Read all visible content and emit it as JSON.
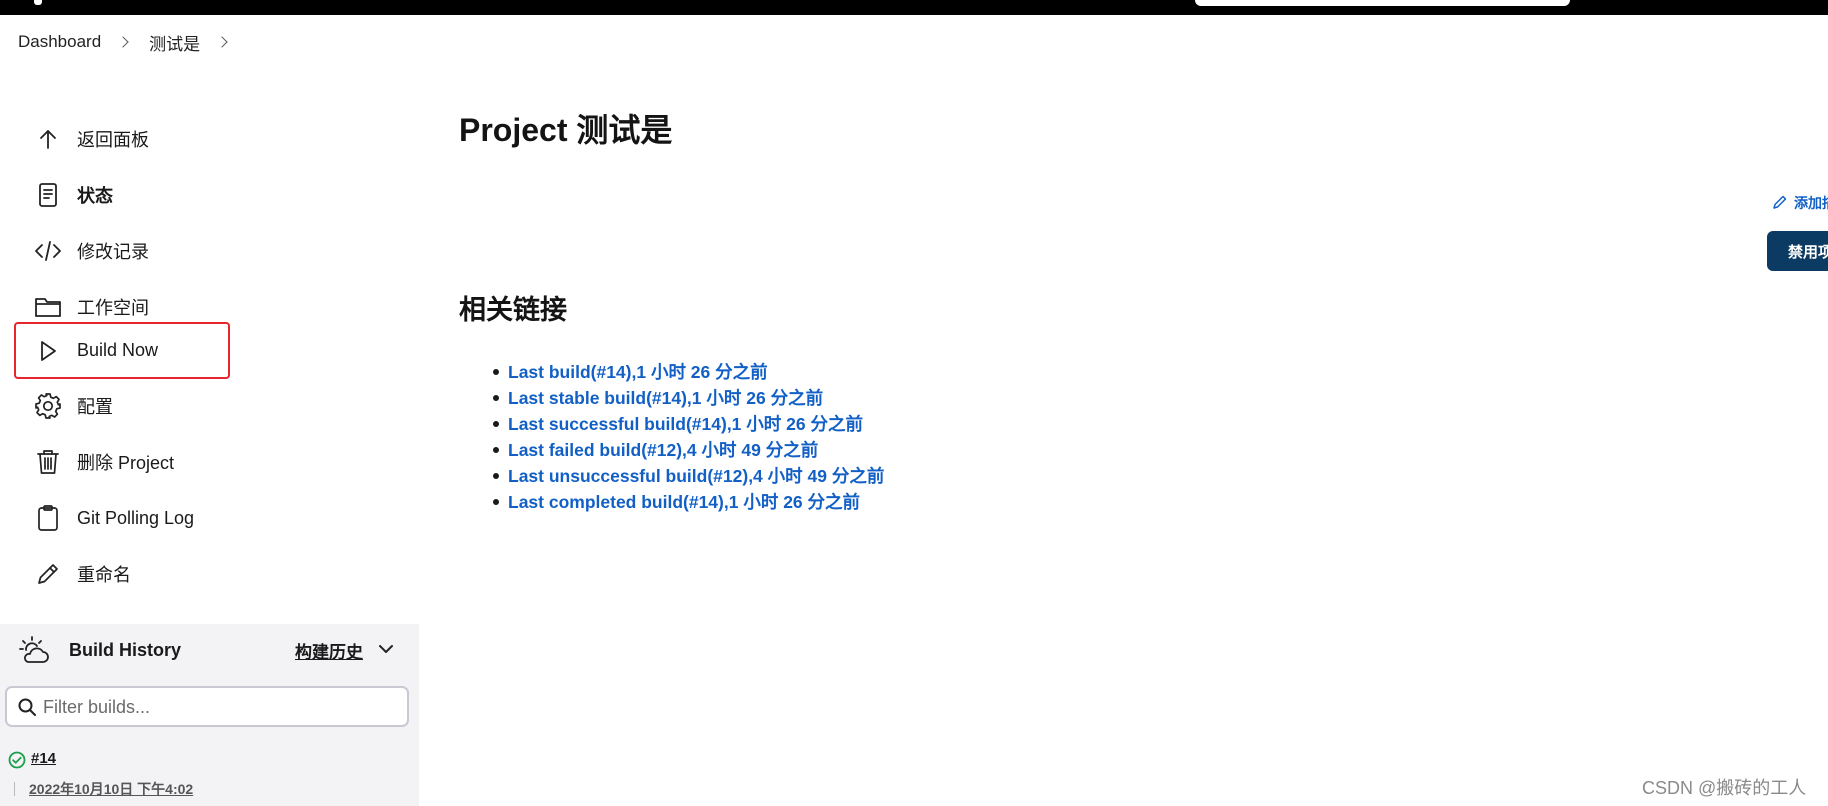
{
  "breadcrumb": {
    "items": [
      "Dashboard",
      "测试是"
    ]
  },
  "sidebar": {
    "items": [
      {
        "label": "返回面板",
        "icon": "arrow-up-icon"
      },
      {
        "label": "状态",
        "icon": "document-icon"
      },
      {
        "label": "修改记录",
        "icon": "code-icon"
      },
      {
        "label": "工作空间",
        "icon": "folder-icon"
      },
      {
        "label": "Build Now",
        "icon": "play-icon"
      },
      {
        "label": "配置",
        "icon": "gear-icon"
      },
      {
        "label": "删除 Project",
        "icon": "trash-icon"
      },
      {
        "label": "Git Polling Log",
        "icon": "clipboard-icon"
      },
      {
        "label": "重命名",
        "icon": "pencil-icon"
      }
    ]
  },
  "build_history": {
    "title": "Build History",
    "trend_label": "构建历史",
    "filter_placeholder": "Filter builds...",
    "builds": [
      {
        "number": "#14",
        "date": "2022年10月10日 下午4:02",
        "status": "success"
      }
    ]
  },
  "main": {
    "title": "Project 测试是",
    "related_links_heading": "相关链接",
    "links": [
      "Last build(#14),1 小时 26 分之前",
      "Last stable build(#14),1 小时 26 分之前",
      "Last successful build(#14),1 小时 26 分之前",
      "Last failed build(#12),4 小时 49 分之前",
      "Last unsuccessful build(#12),4 小时 49 分之前",
      "Last completed build(#14),1 小时 26 分之前"
    ]
  },
  "actions": {
    "add_description": "添加描述",
    "disable_project": "禁用项目"
  },
  "watermark": "CSDN @搬砖的工人",
  "colors": {
    "link": "#1260c6",
    "highlight_border": "#e8242c",
    "primary_button": "#0b3b63",
    "success": "#1e9e4a"
  }
}
